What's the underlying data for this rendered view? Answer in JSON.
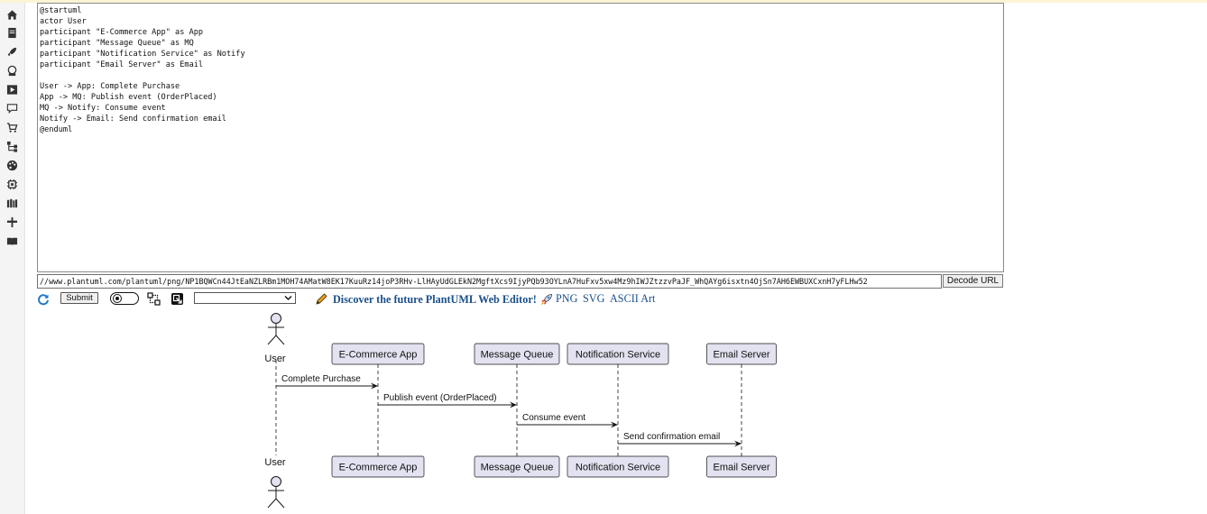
{
  "editor": {
    "source": "@startuml\nactor User\nparticipant \"E-Commerce App\" as App\nparticipant \"Message Queue\" as MQ\nparticipant \"Notification Service\" as Notify\nparticipant \"Email Server\" as Email\n\nUser -> App: Complete Purchase\nApp -> MQ: Publish event (OrderPlaced)\nMQ -> Notify: Consume event\nNotify -> Email: Send confirmation email\n@enduml"
  },
  "sidebar": {
    "icons": [
      "home-icon",
      "document-icon",
      "rocket-icon",
      "network-icon",
      "play-icon",
      "comment-icon",
      "cart-icon",
      "hierarchy-icon",
      "palette-icon",
      "chip-icon",
      "library-icon",
      "pin-icon",
      "book-icon"
    ]
  },
  "toolbar": {
    "url_value": "//www.plantuml.com/plantuml/png/NP1BQWCn44JtEaNZLRBm1MOH74AMatW8EK17KuuRz14joP3RHv-LlHAyUdGLEkN2MgftXcs9IjyPQb93OYLnA7HuFxv5xw4Mz9hIWJZtzzvPaJF_WhQAYg6isxtn4OjSn7AH6EWBUXCxnH7yFLHw52",
    "decode_label": "Decode URL",
    "submit_label": "Submit",
    "select_value": "",
    "discover_label": "Discover the future PlantUML Web Editor!",
    "png_label": "PNG",
    "svg_label": "SVG",
    "ascii_label": "ASCII Art"
  },
  "diagram": {
    "actor": "User",
    "participants": [
      "E-Commerce App",
      "Message Queue",
      "Notification Service",
      "Email Server"
    ],
    "messages": [
      {
        "from": "User",
        "to": "E-Commerce App",
        "label": "Complete Purchase"
      },
      {
        "from": "E-Commerce App",
        "to": "Message Queue",
        "label": "Publish event (OrderPlaced)"
      },
      {
        "from": "Message Queue",
        "to": "Notification Service",
        "label": "Consume event"
      },
      {
        "from": "Notification Service",
        "to": "Email Server",
        "label": "Send confirmation email"
      }
    ]
  },
  "colors": {
    "participant_fill": "#e2e2f0",
    "participant_border": "#181818",
    "link": "#1a4f8a"
  }
}
